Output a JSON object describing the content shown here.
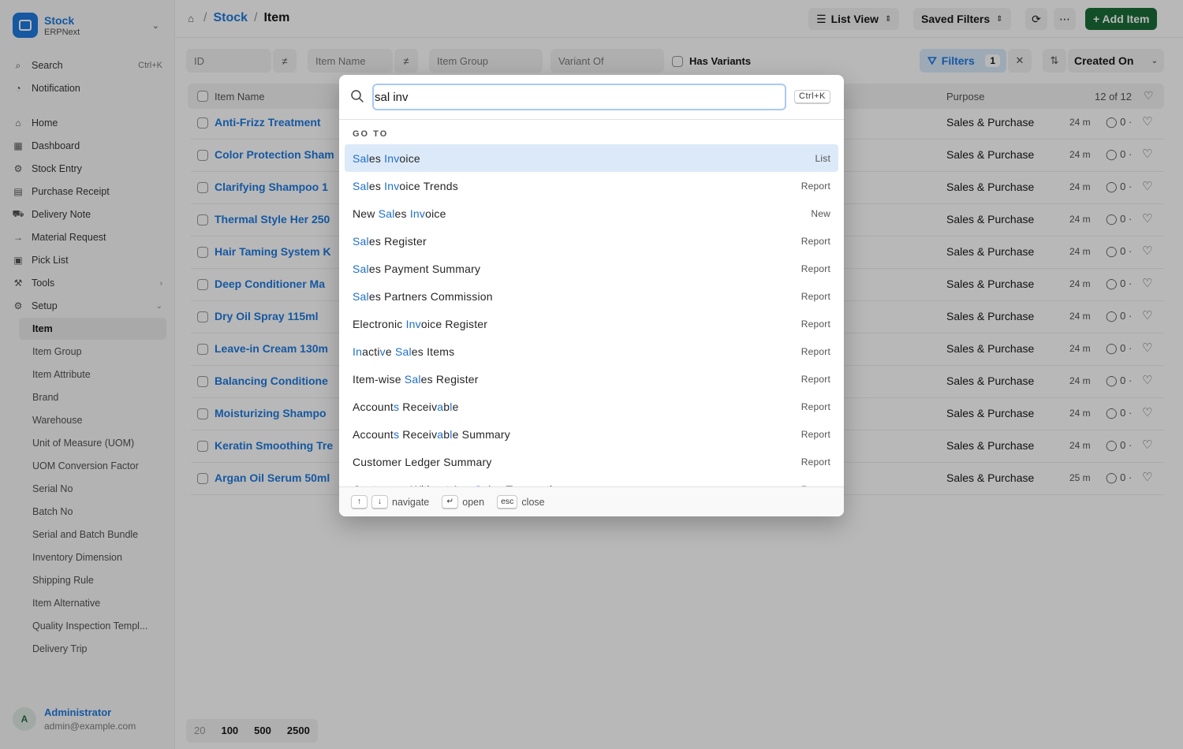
{
  "app": {
    "name": "Stock",
    "subtitle": "ERPNext",
    "logo_color": "#1f7ae0"
  },
  "sidebar": {
    "search_label": "Search",
    "search_shortcut": "Ctrl+K",
    "notification_label": "Notification",
    "items": [
      {
        "label": "Home",
        "icon": "home-icon"
      },
      {
        "label": "Dashboard",
        "icon": "dashboard-icon"
      },
      {
        "label": "Stock Entry",
        "icon": "gear-icon"
      },
      {
        "label": "Purchase Receipt",
        "icon": "receipt-icon"
      },
      {
        "label": "Delivery Note",
        "icon": "truck-icon"
      },
      {
        "label": "Material Request",
        "icon": "arrow-icon"
      },
      {
        "label": "Pick List",
        "icon": "pick-icon"
      },
      {
        "label": "Tools",
        "icon": "tools-icon"
      },
      {
        "label": "Setup",
        "icon": "settings-icon"
      }
    ],
    "setup_children": [
      "Item",
      "Item Group",
      "Item Attribute",
      "Brand",
      "Warehouse",
      "Unit of Measure (UOM)",
      "UOM Conversion Factor",
      "Serial No",
      "Batch No",
      "Serial and Batch Bundle",
      "Inventory Dimension",
      "Shipping Rule",
      "Item Alternative",
      "Quality Inspection Templ...",
      "Delivery Trip"
    ],
    "active_item": "Item"
  },
  "user": {
    "initial": "A",
    "name": "Administrator",
    "email": "admin@example.com"
  },
  "header": {
    "breadcrumb": [
      "Stock",
      "Item"
    ],
    "list_view_label": "List View",
    "saved_filters_label": "Saved Filters",
    "add_label": "+ Add Item",
    "primary_color": "#1a6e38"
  },
  "filters": {
    "id_placeholder": "ID",
    "item_name_placeholder": "Item Name",
    "item_group_placeholder": "Item Group",
    "variant_of_placeholder": "Variant Of",
    "has_variants_label": "Has Variants",
    "filters_label": "Filters",
    "filters_count": "1",
    "sort_label": "Created On"
  },
  "list": {
    "columns": {
      "name": "Item Name",
      "purpose": "Purpose",
      "count": "12 of 12"
    },
    "rows": [
      {
        "name": "Anti-Frizz Treatment",
        "purpose": "Sales & Purchase",
        "time": "24 m",
        "comments": "0"
      },
      {
        "name": "Color Protection Sham",
        "purpose": "Sales & Purchase",
        "time": "24 m",
        "comments": "0"
      },
      {
        "name": "Clarifying Shampoo 1",
        "purpose": "Sales & Purchase",
        "time": "24 m",
        "comments": "0"
      },
      {
        "name": "Thermal Style Her 250",
        "purpose": "Sales & Purchase",
        "time": "24 m",
        "comments": "0"
      },
      {
        "name": "Hair Taming System K",
        "purpose": "Sales & Purchase",
        "time": "24 m",
        "comments": "0"
      },
      {
        "name": "Deep Conditioner Ma",
        "purpose": "Sales & Purchase",
        "time": "24 m",
        "comments": "0"
      },
      {
        "name": "Dry Oil Spray 115ml",
        "purpose": "Sales & Purchase",
        "time": "24 m",
        "comments": "0"
      },
      {
        "name": "Leave-in Cream 130m",
        "purpose": "Sales & Purchase",
        "time": "24 m",
        "comments": "0"
      },
      {
        "name": "Balancing Conditione",
        "purpose": "Sales & Purchase",
        "time": "24 m",
        "comments": "0"
      },
      {
        "name": "Moisturizing Shampo",
        "purpose": "Sales & Purchase",
        "time": "24 m",
        "comments": "0"
      },
      {
        "name": "Keratin Smoothing Tre",
        "purpose": "Sales & Purchase",
        "time": "24 m",
        "comments": "0"
      },
      {
        "name": "Argan Oil Serum 50ml",
        "purpose": "Sales & Purchase",
        "time": "25 m",
        "comments": "0"
      }
    ],
    "page_sizes": [
      "20",
      "100",
      "500",
      "2500"
    ]
  },
  "palette": {
    "query": "sal inv",
    "shortcut": "Ctrl+K",
    "section_label": "GO TO",
    "results": [
      {
        "parts": [
          [
            "Sal",
            1
          ],
          [
            "es ",
            0
          ],
          [
            "Inv",
            1
          ],
          [
            "oice",
            0
          ]
        ],
        "type": "List"
      },
      {
        "parts": [
          [
            "Sal",
            1
          ],
          [
            "es ",
            0
          ],
          [
            "Inv",
            1
          ],
          [
            "oice Trends",
            0
          ]
        ],
        "type": "Report"
      },
      {
        "parts": [
          [
            "New ",
            0
          ],
          [
            "Sal",
            1
          ],
          [
            "es ",
            0
          ],
          [
            "Inv",
            1
          ],
          [
            "oice",
            0
          ]
        ],
        "type": "New"
      },
      {
        "parts": [
          [
            "Sal",
            1
          ],
          [
            "es Register",
            0
          ]
        ],
        "type": "Report"
      },
      {
        "parts": [
          [
            "Sal",
            1
          ],
          [
            "es Payment Summary",
            0
          ]
        ],
        "type": "Report"
      },
      {
        "parts": [
          [
            "Sal",
            1
          ],
          [
            "es Partners Commission",
            0
          ]
        ],
        "type": "Report"
      },
      {
        "parts": [
          [
            "Electronic ",
            0
          ],
          [
            "Inv",
            1
          ],
          [
            "oice Register",
            0
          ]
        ],
        "type": "Report"
      },
      {
        "parts": [
          [
            "In",
            1
          ],
          [
            "acti",
            0
          ],
          [
            "v",
            1
          ],
          [
            "e ",
            0
          ],
          [
            "Sal",
            1
          ],
          [
            "es Items",
            0
          ]
        ],
        "type": "Report"
      },
      {
        "parts": [
          [
            "Item-wise ",
            0
          ],
          [
            "Sal",
            1
          ],
          [
            "es Register",
            0
          ]
        ],
        "type": "Report"
      },
      {
        "parts": [
          [
            "Account",
            0
          ],
          [
            "s",
            1
          ],
          [
            " Recei",
            0
          ],
          [
            "v",
            0
          ],
          [
            "a",
            1
          ],
          [
            "b",
            0
          ],
          [
            "l",
            1
          ],
          [
            "e",
            0
          ]
        ],
        "type": "Report"
      },
      {
        "parts": [
          [
            "Account",
            0
          ],
          [
            "s",
            1
          ],
          [
            " Recei",
            0
          ],
          [
            "v",
            0
          ],
          [
            "a",
            1
          ],
          [
            "b",
            0
          ],
          [
            "l",
            1
          ],
          [
            "e Summary",
            0
          ]
        ],
        "type": "Report"
      },
      {
        "parts": [
          [
            "Customer Ledger Summary",
            0
          ]
        ],
        "type": "Report"
      },
      {
        "parts": [
          [
            "Customers Without Any ",
            0
          ],
          [
            "Sal",
            1
          ],
          [
            "es Transactions",
            0
          ]
        ],
        "type": "Report"
      }
    ],
    "footer": {
      "navigate": "navigate",
      "open": "open",
      "close": "close",
      "esc": "esc",
      "enter": "↵",
      "up": "↑",
      "down": "↓"
    },
    "highlight_color": "#1f6fc8"
  }
}
